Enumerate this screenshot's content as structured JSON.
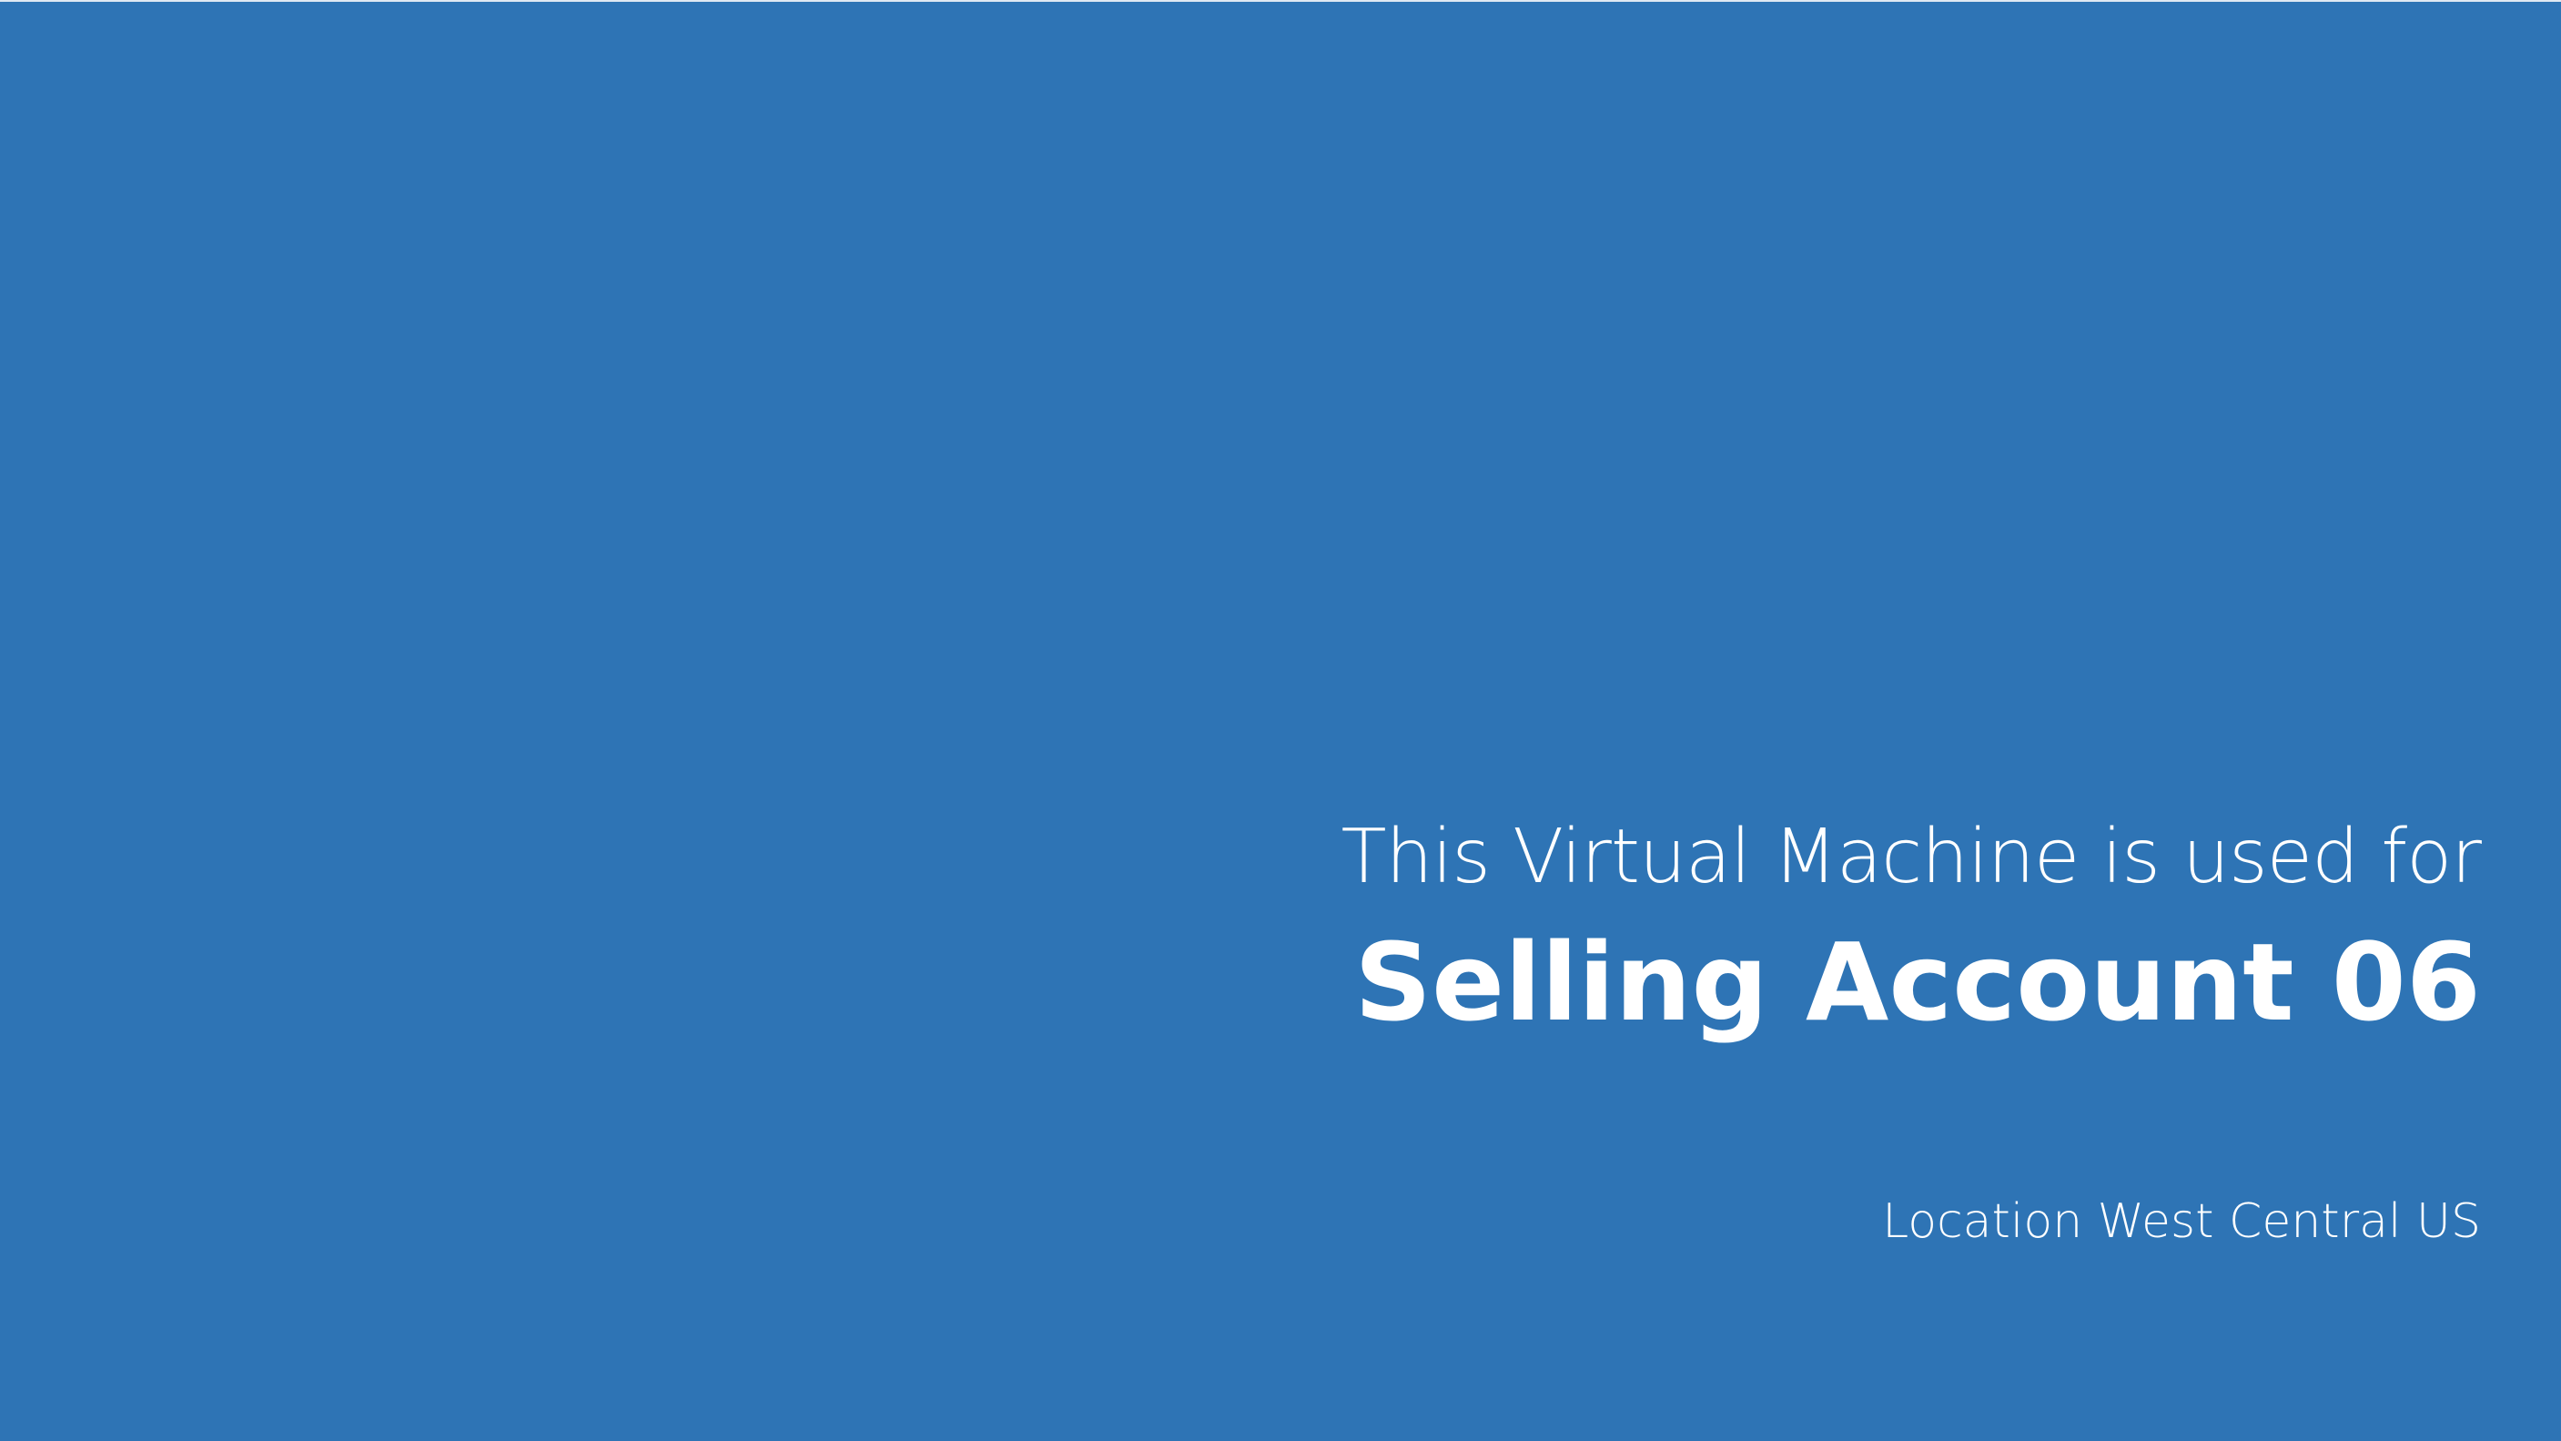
{
  "background_color": "#2e74b5",
  "text_color": "#ffffff",
  "wallpaper": {
    "intro_text": "This Virtual Machine is used for",
    "account_name": "Selling Account 06",
    "location_text": "Location West Central US"
  }
}
